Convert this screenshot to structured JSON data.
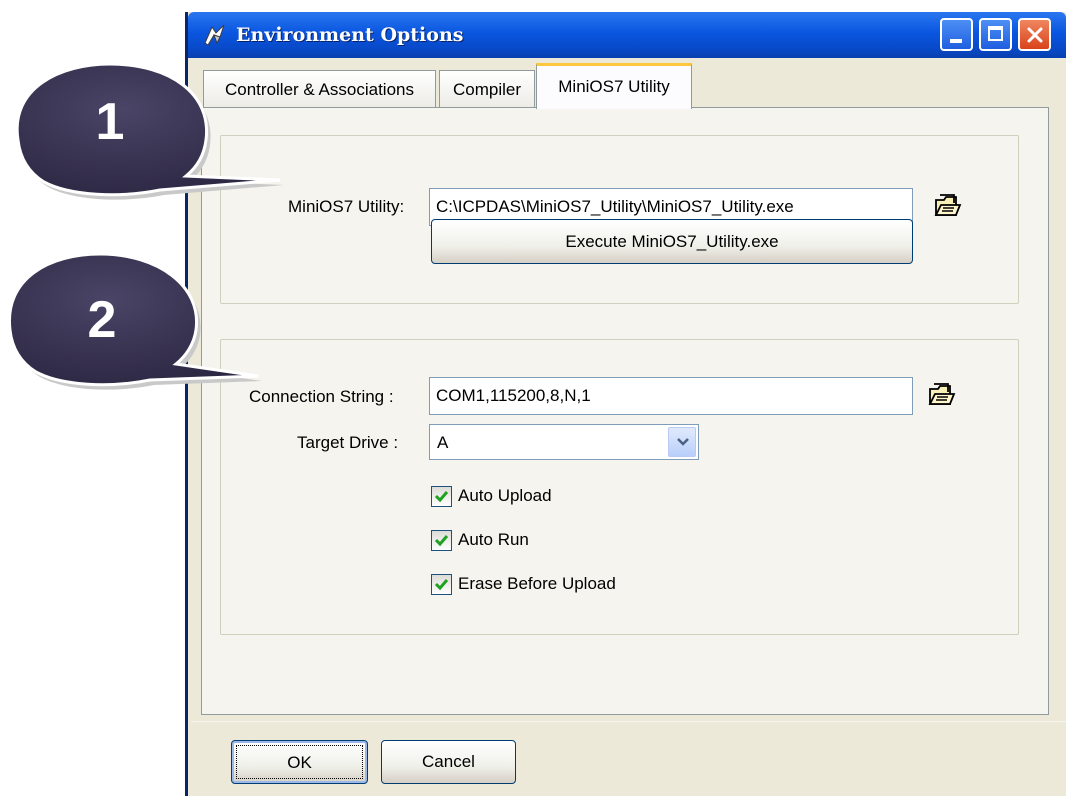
{
  "window": {
    "title": "Environment Options"
  },
  "tabs": [
    {
      "label": "Controller & Associations",
      "active": false
    },
    {
      "label": "Compiler",
      "active": false
    },
    {
      "label": "MiniOS7 Utility",
      "active": true
    }
  ],
  "utility_group": {
    "path_label": "MiniOS7 Utility:",
    "path_value": "C:\\ICPDAS\\MiniOS7_Utility\\MiniOS7_Utility.exe",
    "execute_label": "Execute MiniOS7_Utility.exe"
  },
  "connection_group": {
    "connection_label": "Connection String :",
    "connection_value": "COM1,115200,8,N,1",
    "drive_label": "Target Drive :",
    "drive_value": "A",
    "checkboxes": [
      {
        "label": "Auto Upload",
        "checked": true
      },
      {
        "label": "Auto Run",
        "checked": true
      },
      {
        "label": "Erase Before Upload",
        "checked": true
      }
    ]
  },
  "buttons": {
    "ok": "OK",
    "cancel": "Cancel"
  },
  "callouts": [
    "1",
    "2"
  ],
  "colors": {
    "titlebar": "#0a56e0",
    "callout": "#3b3552",
    "checkmark": "#21a121",
    "active_tab_highlight": "#ffc83c"
  }
}
